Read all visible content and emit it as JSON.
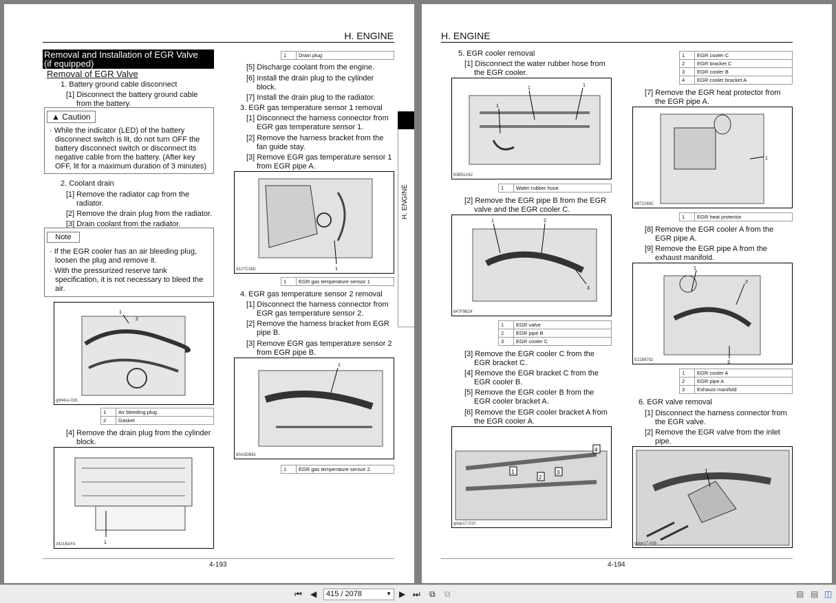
{
  "left_page": {
    "header": "H. ENGINE",
    "section_title_line1": "Removal and Installation of EGR Valve",
    "section_title_line2": "(if equipped)",
    "subsection": "Removal of EGR Valve",
    "s1": "1. Battery ground cable disconnect",
    "s1_1a": "[1] Disconnect the battery ground cable",
    "s1_1b": "from the battery.",
    "caution_label": "Caution",
    "caution_l1": "· While the indicator (LED) of the battery",
    "caution_l2": "disconnect switch is lit, do not turn OFF the",
    "caution_l3": "battery disconnect switch or disconnect its",
    "caution_l4": "negative cable from the battery. (After key",
    "caution_l5": "OFF, lit for a maximum duration of 3 minutes)",
    "s2": "2. Coolant drain",
    "s2_1a": "[1] Remove the radiator cap from the",
    "s2_1b": "radiator.",
    "s2_2": "[2] Remove the drain plug from the radiator.",
    "s2_3": "[3] Drain coolant from the radiator.",
    "note_label": "Note",
    "note_l1": "· If the EGR cooler has an air bleeding plug,",
    "note_l2": "loosen the plug and remove it.",
    "note_l3": "· With the pressurized reserve tank",
    "note_l4": "specification, it is not necessary to bleed the",
    "note_l5": "air.",
    "fig1_code": "gbh4sv-016",
    "fig1_legend": [
      [
        "1",
        "Air bleeding plug"
      ],
      [
        "2",
        "Gasket"
      ]
    ],
    "s2_4a": "[4] Remove the drain plug from the cylinder",
    "s2_4b": "block.",
    "fig2_code": "0421BAFA",
    "drain_legend": [
      [
        "1",
        "Drain plug"
      ]
    ],
    "s2_5": "[5] Discharge coolant from the engine.",
    "s2_6a": "[6] Install the drain plug to the cylinder",
    "s2_6b": "block.",
    "s2_7": "[7] Install the drain plug to the radiator.",
    "s3": "3. EGR gas temperature sensor 1 removal",
    "s3_1a": "[1] Disconnect the harness connector from",
    "s3_1b": "EGR gas temperature sensor 1.",
    "s3_2a": "[2] Remove the harness bracket from the",
    "s3_2b": "fan guide stay.",
    "s3_3a": "[3] Remove EGR gas temperature sensor 1",
    "s3_3b": "from EGR pipe A.",
    "fig3_code": "4127C16D",
    "fig3_legend": [
      [
        "1",
        "EGR gas temperature sensor 1"
      ]
    ],
    "s4": "4. EGR gas temperature sensor 2 removal",
    "s4_1a": "[1] Disconnect the harness connector from",
    "s4_1b": "EGR gas temperature sensor 2.",
    "s4_2a": "[2] Remove the harness bracket from EGR",
    "s4_2b": "pipe B.",
    "s4_3a": "[3] Remove EGR gas temperature sensor 2",
    "s4_3b": "from EGR pipe B.",
    "fig4_code": "80A3DB81",
    "fig4_legend": [
      [
        "1",
        "EGR gas temperature sensor 2"
      ]
    ],
    "side_tab": "H. ENGINE",
    "page_number": "4-193"
  },
  "right_page": {
    "header": "H. ENGINE",
    "s5": "5. EGR cooler removal",
    "s5_1a": "[1] Disconnect the water rubber hose from",
    "s5_1b": "the EGR cooler.",
    "fig5_code": "83B51A92",
    "fig5_legend": [
      [
        "1",
        "Water rubber hose"
      ]
    ],
    "s5_2a": "[2] Remove the EGR pipe B from the EGR",
    "s5_2b": "valve and the EGR cooler C.",
    "fig6_code": "847F9B24",
    "fig6_legend": [
      [
        "1",
        "EGR valve"
      ],
      [
        "2",
        "EGR pipe B"
      ],
      [
        "3",
        "EGR cooler C"
      ]
    ],
    "s5_3a": "[3] Remove the EGR cooler C from the",
    "s5_3b": "EGR bracket C.",
    "s5_4a": "[4] Remove the EGR bracket C from the",
    "s5_4b": "EGR cooler B.",
    "s5_5a": "[5] Remove the EGR cooler B from the",
    "s5_5b": "EGR cooler bracket A.",
    "s5_6a": "[6] Remove the EGR cooler bracket A from",
    "s5_6b": "the EGR cooler A.",
    "fig7_code": "gdqe17-010",
    "top_legend": [
      [
        "1",
        "EGR cooler C"
      ],
      [
        "2",
        "EGR bracket C"
      ],
      [
        "3",
        "EGR cooler B"
      ],
      [
        "4",
        "EGR cooler bracket A"
      ]
    ],
    "s5_7a": "[7] Remove the EGR heat protector from",
    "s5_7b": "the EGR pipe A.",
    "fig8_code": "8B72269C",
    "fig8_legend": [
      [
        "1",
        "EGR heat protector"
      ]
    ],
    "s5_8a": "[8] Remove the EGR cooler A from the",
    "s5_8b": "EGR pipe A.",
    "s5_9a": "[9] Remove the EGR pipe A from the",
    "s5_9b": "exhaust manifold.",
    "fig9_code": "E2289792",
    "fig9_legend": [
      [
        "1",
        "EGR cooler A"
      ],
      [
        "2",
        "EGR pipe A"
      ],
      [
        "3",
        "Exhaust manifold"
      ]
    ],
    "s6": "6. EGR valve removal",
    "s6_1a": "[1] Disconnect the harness connector from",
    "s6_1b": "the EGR valve.",
    "s6_2a": "[2] Remove the EGR valve from the inlet",
    "s6_2b": "pipe.",
    "fig10_code": "gdqe17-008",
    "page_number": "4-194"
  },
  "toolbar": {
    "page_indicator": "415 / 2078",
    "icons": [
      "first-page-icon",
      "prev-page-icon",
      "next-page-icon",
      "last-page-icon",
      "back-view-icon",
      "forward-view-icon",
      "single-page-icon",
      "continuous-icon",
      "two-page-icon"
    ]
  }
}
